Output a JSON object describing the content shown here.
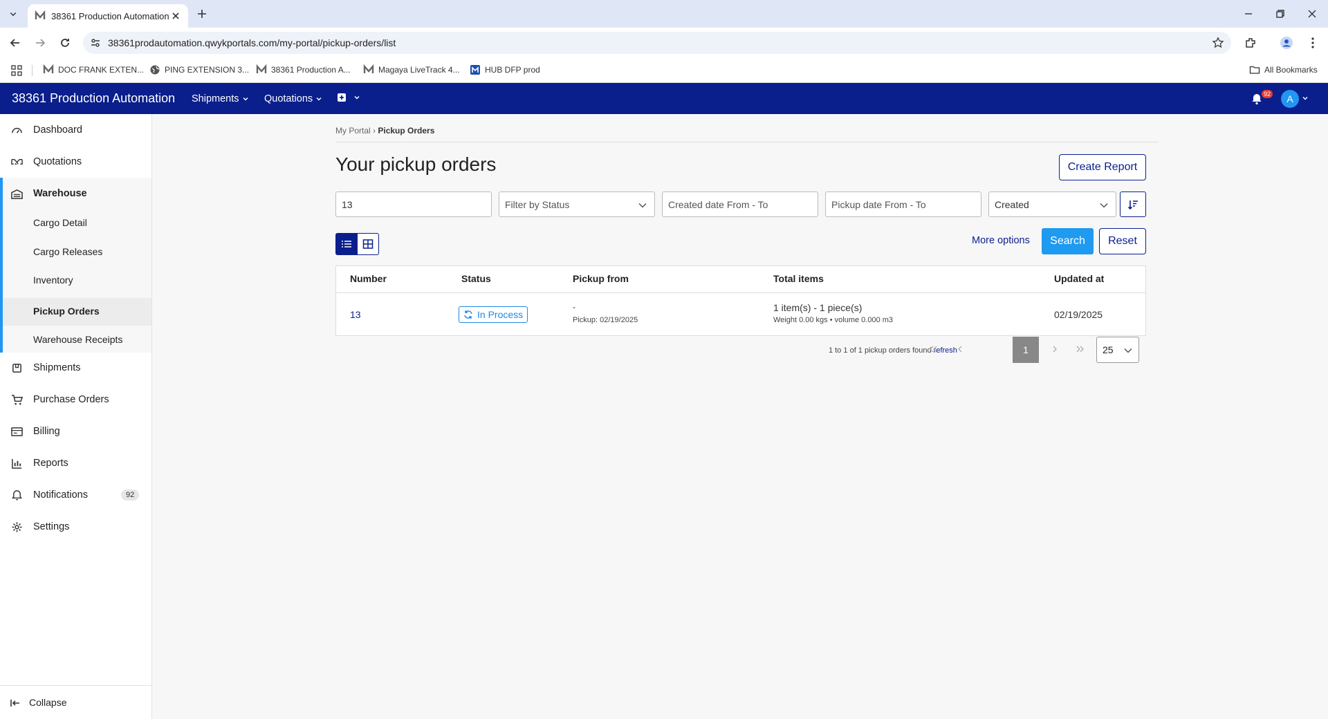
{
  "browser": {
    "tab_title": "38361 Production Automation",
    "url": "38361prodautomation.qwykportals.com/my-portal/pickup-orders/list",
    "bookmarks": [
      "DOC FRANK EXTEN...",
      "PING EXTENSION 3...",
      "38361 Production A...",
      "Magaya LiveTrack 4...",
      "HUB DFP prod"
    ],
    "all_bookmarks": "All Bookmarks"
  },
  "header": {
    "brand": "38361 Production Automation",
    "nav": [
      "Shipments",
      "Quotations"
    ],
    "notif_count": "92",
    "avatar": "A",
    "color": "#0a1e8c"
  },
  "sidebar": {
    "items": [
      "Dashboard",
      "Quotations",
      "Warehouse",
      "Shipments",
      "Purchase Orders",
      "Billing",
      "Reports",
      "Notifications",
      "Settings"
    ],
    "warehouse_sub": [
      "Cargo Detail",
      "Cargo Releases",
      "Inventory",
      "Pickup Orders",
      "Warehouse Receipts"
    ],
    "notifications_badge": "92",
    "collapse": "Collapse"
  },
  "main": {
    "breadcrumb": {
      "root": "My Portal",
      "sep": " › ",
      "current": "Pickup Orders"
    },
    "title": "Your pickup orders",
    "create_report": "Create Report",
    "filters": {
      "search_value": "13",
      "status_placeholder": "Filter by Status",
      "created_placeholder": "Created date From - To",
      "pickup_placeholder": "Pickup date From - To",
      "sort_value": "Created"
    },
    "more_options": "More options",
    "search": "Search",
    "reset": "Reset",
    "table": {
      "headers": [
        "Number",
        "Status",
        "Pickup from",
        "Total items",
        "Updated at"
      ],
      "rows": [
        {
          "number": "13",
          "status": "In Process",
          "pickup_from": "-",
          "pickup_date": "Pickup: 02/19/2025",
          "items": "1 item(s) - 1 piece(s)",
          "weight": "Weight 0.00 kgs • volume 0.000 m3",
          "updated": "02/19/2025"
        }
      ]
    },
    "pager": {
      "info": "1 to 1 of 1 pickup orders found",
      "refresh": "refresh",
      "current": "1",
      "page_size": "25"
    }
  }
}
